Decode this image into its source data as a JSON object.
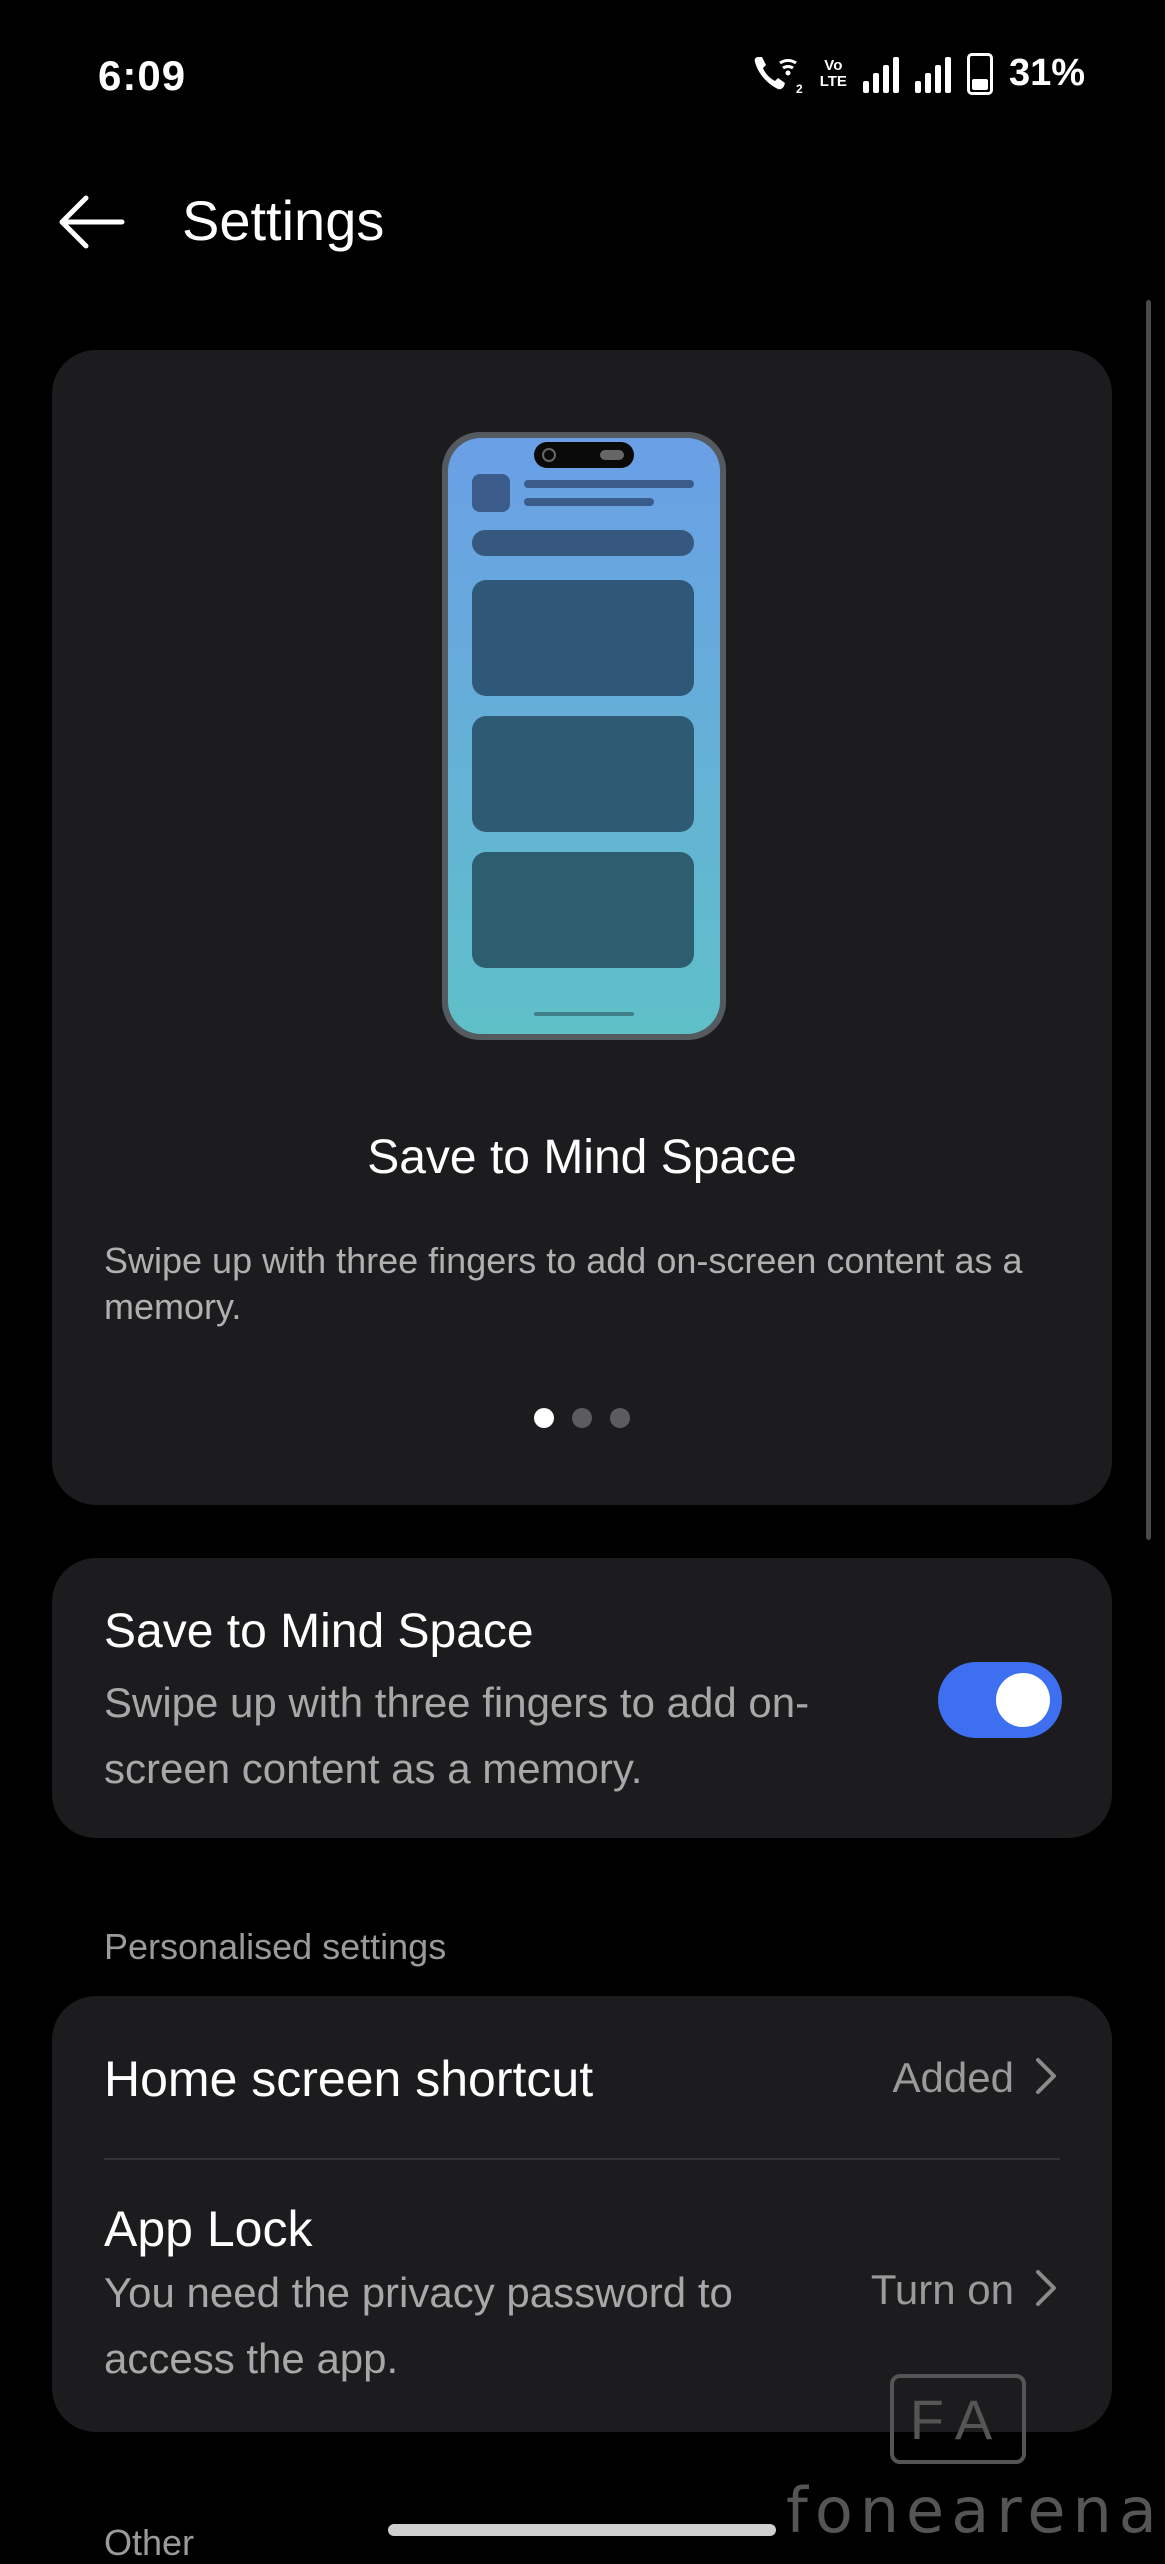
{
  "status_bar": {
    "time": "6:09",
    "volte_top": "Vo",
    "volte_bottom": "LTE",
    "battery": "31%"
  },
  "header": {
    "title": "Settings"
  },
  "hero": {
    "title": "Save to Mind Space",
    "description": "Swipe up with three fingers to add on-screen content as a memory.",
    "page_count": 3,
    "active_page": 1
  },
  "toggle_card": {
    "title": "Save to Mind Space",
    "description": "Swipe up with three fingers to add on-screen content as a memory.",
    "enabled": true
  },
  "personalised": {
    "section_label": "Personalised settings",
    "home_shortcut": {
      "title": "Home screen shortcut",
      "value": "Added"
    },
    "app_lock": {
      "title": "App Lock",
      "description": "You need the privacy password to access the app.",
      "value": "Turn on"
    }
  },
  "other": {
    "section_label": "Other"
  },
  "watermark": {
    "logo": "FA",
    "text": "fonearena"
  },
  "colors": {
    "accent": "#3d6ff0",
    "card": "#1c1c1e",
    "background": "#000000"
  }
}
